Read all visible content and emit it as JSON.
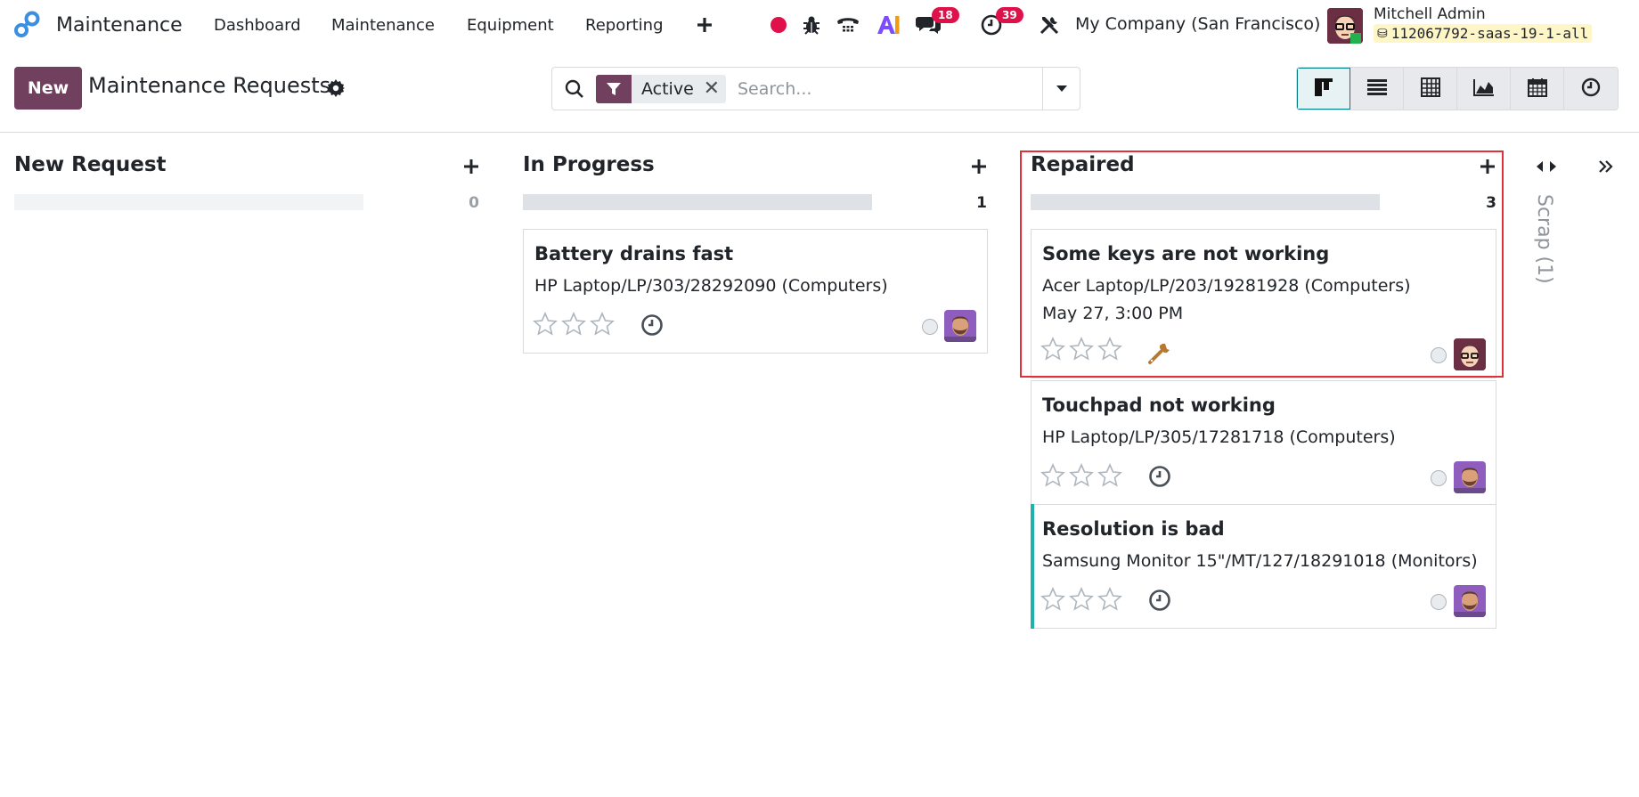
{
  "navbar": {
    "app_name": "Maintenance",
    "menu": [
      "Dashboard",
      "Maintenance",
      "Equipment",
      "Reporting"
    ],
    "messages_badge": "18",
    "activities_badge": "39",
    "company": "My Company (San Francisco)",
    "user_name": "Mitchell Admin",
    "database": "112067792-saas-19-1-all",
    "icons": [
      "app-logo-icon",
      "plus-icon",
      "record-icon",
      "bug-icon",
      "phone-icon",
      "ai-icon",
      "chat-icon",
      "clock-icon",
      "tools-icon"
    ]
  },
  "control_panel": {
    "new_label": "New",
    "title": "Maintenance Requests",
    "facet_label": "Active",
    "search_placeholder": "Search...",
    "views": [
      "kanban",
      "list",
      "pivot",
      "graph",
      "calendar",
      "activity"
    ],
    "active_view": "kanban"
  },
  "columns": [
    {
      "title": "New Request",
      "count": "0",
      "cards": []
    },
    {
      "title": "In Progress",
      "count": "1",
      "cards": [
        {
          "title": "Battery drains fast",
          "equipment": "HP Laptop/LP/303/28292090 (Computers)",
          "date": "",
          "activity": "clock-icon",
          "avatar": "bearded-man"
        }
      ]
    },
    {
      "title": "Repaired",
      "count": "3",
      "cards": [
        {
          "title": "Some keys are not working",
          "equipment": "Acer Laptop/LP/203/19281928 (Computers)",
          "date": "May 27, 3:00 PM",
          "activity": "wrench-icon",
          "avatar": "glasses-man"
        },
        {
          "title": "Touchpad not working",
          "equipment": "HP Laptop/LP/305/17281718 (Computers)",
          "date": "",
          "activity": "clock-icon",
          "avatar": "bearded-man"
        },
        {
          "title": "Resolution is bad",
          "equipment": "Samsung Monitor 15\"/MT/127/18291018 (Monitors)",
          "date": "",
          "activity": "clock-icon",
          "avatar": "bearded-man"
        }
      ]
    }
  ],
  "folded_column": {
    "label": "Scrap (1)"
  },
  "colors": {
    "brand": "#71405e",
    "accent": "#017e84",
    "badge": "#e0114a",
    "highlight": "#e0303a",
    "card_accent": "#20b2aa"
  }
}
